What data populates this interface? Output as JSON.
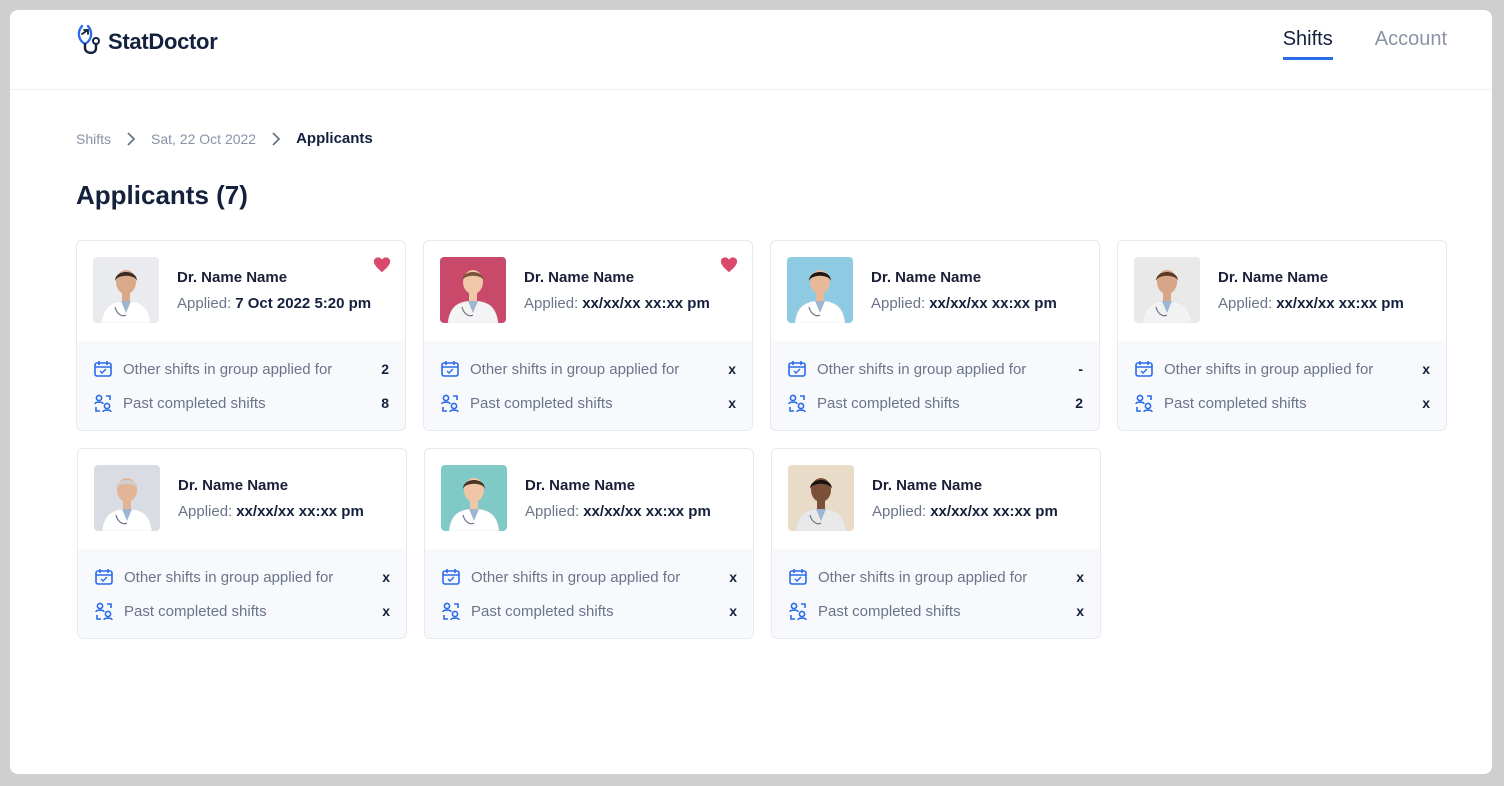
{
  "app": {
    "name": "StatDoctor"
  },
  "nav": {
    "shifts": "Shifts",
    "account": "Account"
  },
  "breadcrumb": {
    "shifts": "Shifts",
    "date": "Sat, 22 Oct 2022",
    "current": "Applicants"
  },
  "page": {
    "title": "Applicants (7)"
  },
  "labels": {
    "applied": "Applied:",
    "other_shifts": "Other shifts in group applied for",
    "past_shifts": "Past completed shifts"
  },
  "colors": {
    "accent": "#2a6be8",
    "heart": "#d9496c",
    "text_dark": "#14213d",
    "text_muted": "#6b7489"
  },
  "icons": {
    "favourite": "heart-icon",
    "calendar": "calendar-icon",
    "past": "user-history-icon",
    "chevron": "chevron-right-icon"
  },
  "applicants": [
    {
      "name": "Dr. Name Name",
      "applied": "7 Oct 2022 5:20 pm",
      "other_shifts": "2",
      "past_shifts": "8",
      "favourite": true
    },
    {
      "name": "Dr. Name Name",
      "applied": "xx/xx/xx xx:xx pm",
      "other_shifts": "x",
      "past_shifts": "x",
      "favourite": true
    },
    {
      "name": "Dr. Name Name",
      "applied": "xx/xx/xx xx:xx pm",
      "other_shifts": "-",
      "past_shifts": "2",
      "favourite": false
    },
    {
      "name": "Dr. Name Name",
      "applied": "xx/xx/xx xx:xx pm",
      "other_shifts": "x",
      "past_shifts": "x",
      "favourite": false
    },
    {
      "name": "Dr. Name Name",
      "applied": "xx/xx/xx xx:xx pm",
      "other_shifts": "x",
      "past_shifts": "x",
      "favourite": false
    },
    {
      "name": "Dr. Name Name",
      "applied": "xx/xx/xx xx:xx pm",
      "other_shifts": "x",
      "past_shifts": "x",
      "favourite": false
    },
    {
      "name": "Dr. Name Name",
      "applied": "xx/xx/xx xx:xx pm",
      "other_shifts": "x",
      "past_shifts": "x",
      "favourite": false
    }
  ]
}
